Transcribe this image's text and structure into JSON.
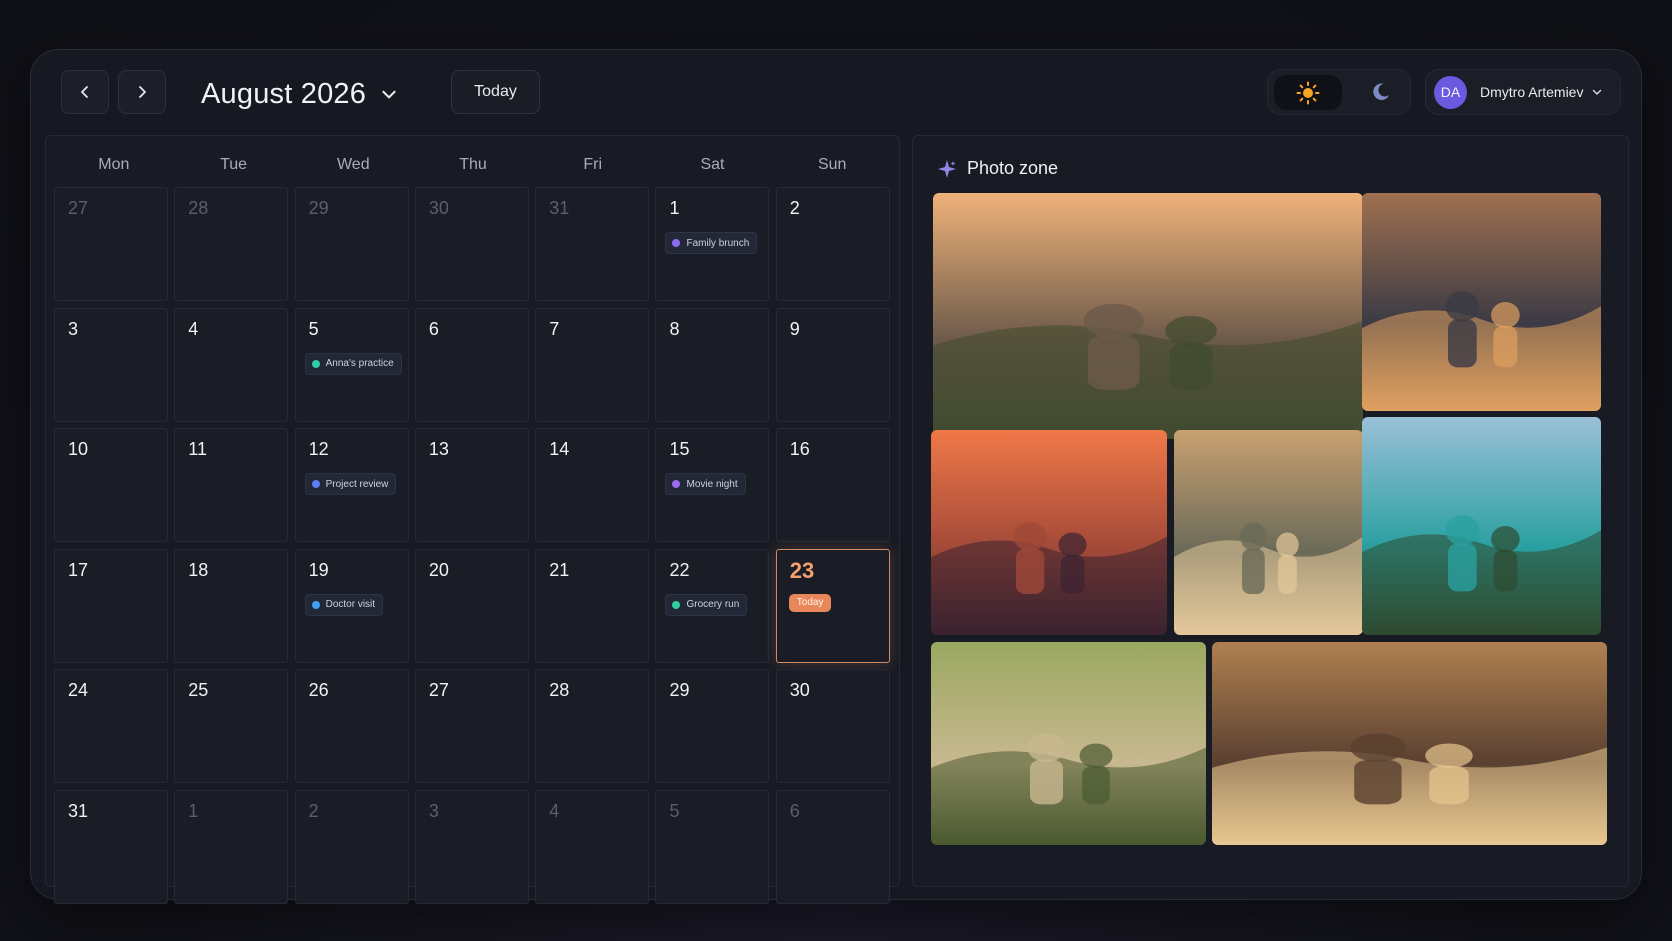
{
  "header": {
    "prev_icon": "chevron-left-icon",
    "next_icon": "chevron-right-icon",
    "month_label": "August 2026",
    "today_label": "Today",
    "theme": {
      "light_icon": "sun-icon",
      "dark_icon": "moon-icon",
      "active": "light"
    },
    "user": {
      "initials": "DA",
      "name": "Dmytro Artemiev"
    }
  },
  "calendar": {
    "weekdays": [
      "Mon",
      "Tue",
      "Wed",
      "Thu",
      "Fri",
      "Sat",
      "Sun"
    ],
    "days": [
      {
        "n": "27",
        "muted": true
      },
      {
        "n": "28",
        "muted": true
      },
      {
        "n": "29",
        "muted": true
      },
      {
        "n": "30",
        "muted": true
      },
      {
        "n": "31",
        "muted": true
      },
      {
        "n": "1",
        "event": {
          "label": "Family brunch",
          "color": "#8b6cf0"
        }
      },
      {
        "n": "2"
      },
      {
        "n": "3"
      },
      {
        "n": "4"
      },
      {
        "n": "5",
        "event": {
          "label": "Anna's practice",
          "color": "#2fcfa6"
        }
      },
      {
        "n": "6"
      },
      {
        "n": "7"
      },
      {
        "n": "8"
      },
      {
        "n": "9"
      },
      {
        "n": "10"
      },
      {
        "n": "11"
      },
      {
        "n": "12",
        "event": {
          "label": "Project review",
          "color": "#5b7cf5"
        }
      },
      {
        "n": "13"
      },
      {
        "n": "14"
      },
      {
        "n": "15",
        "event": {
          "label": "Movie night",
          "color": "#9a6cf0"
        }
      },
      {
        "n": "16"
      },
      {
        "n": "17"
      },
      {
        "n": "18"
      },
      {
        "n": "19",
        "event": {
          "label": "Doctor visit",
          "color": "#3ea2f0"
        }
      },
      {
        "n": "20"
      },
      {
        "n": "21"
      },
      {
        "n": "22",
        "event": {
          "label": "Grocery run",
          "color": "#2fcf9a"
        }
      },
      {
        "n": "23",
        "today": true,
        "badge": "Today"
      },
      {
        "n": "24"
      },
      {
        "n": "25"
      },
      {
        "n": "26"
      },
      {
        "n": "27"
      },
      {
        "n": "28"
      },
      {
        "n": "29"
      },
      {
        "n": "30"
      },
      {
        "n": "31"
      },
      {
        "n": "1",
        "muted": true
      },
      {
        "n": "2",
        "muted": true
      },
      {
        "n": "3",
        "muted": true
      },
      {
        "n": "4",
        "muted": true
      },
      {
        "n": "5",
        "muted": true
      },
      {
        "n": "6",
        "muted": true
      }
    ]
  },
  "photo_zone": {
    "title": "Photo zone",
    "icon": "sparkle-icon",
    "photos": [
      {
        "name": "family-hillside-photo",
        "palette": [
          "#f0b27a",
          "#6d5a4a",
          "#3f4a2e"
        ]
      },
      {
        "name": "birthday-cake-photo",
        "palette": [
          "#a07050",
          "#3b3a44",
          "#e0a060"
        ]
      },
      {
        "name": "beach-sunset-photo",
        "palette": [
          "#f07848",
          "#a04838",
          "#3a2230"
        ]
      },
      {
        "name": "girl-with-dog-photo",
        "palette": [
          "#c8a070",
          "#6a6a58",
          "#e4c89a"
        ]
      },
      {
        "name": "mountain-lake-photo",
        "palette": [
          "#9ac0d8",
          "#2aa0a0",
          "#2f4a30"
        ]
      },
      {
        "name": "kids-bubbles-photo",
        "palette": [
          "#9aa860",
          "#c8b890",
          "#4a5a30"
        ]
      },
      {
        "name": "family-reading-photo",
        "palette": [
          "#b08050",
          "#5a4030",
          "#e8c890"
        ]
      }
    ]
  }
}
